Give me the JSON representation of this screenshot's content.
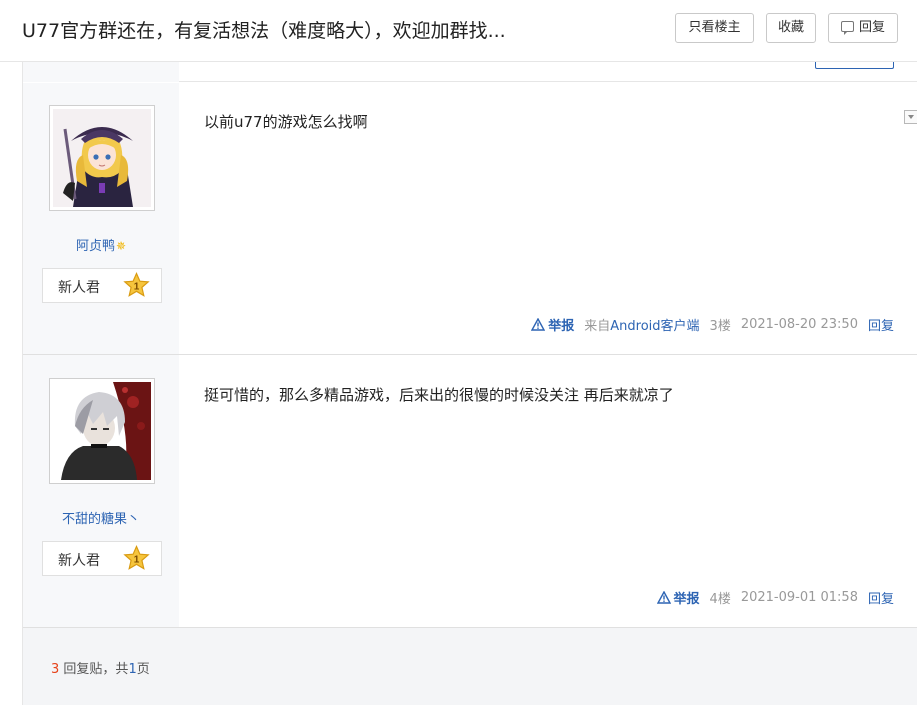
{
  "header": {
    "title": "U77官方群还在，有复活想法（难度略大），欢迎加群找...",
    "buttons": {
      "only_op": "只看楼主",
      "favorite": "收藏",
      "reply": "回复"
    }
  },
  "posts": [
    {
      "username": "阿贞鸭",
      "level_name": "新人君",
      "level_num": "1",
      "content": "以前u77的游戏怎么找啊",
      "report": "举报",
      "client_prefix": "来自",
      "client_name": "Android客户端",
      "floor": "3楼",
      "time": "2021-08-20 23:50",
      "reply": "回复"
    },
    {
      "username": "不甜的糖果丶",
      "level_name": "新人君",
      "level_num": "1",
      "content": "挺可惜的，那么多精品游戏，后来出的很慢的时候没关注 再后来就凉了",
      "report": "举报",
      "floor": "4楼",
      "time": "2021-09-01 01:58",
      "reply": "回复"
    }
  ],
  "footer": {
    "reply_count": "3",
    "reply_label": "回复贴，共",
    "page_count": "1",
    "page_label": "页"
  },
  "colors": {
    "link": "#2d64b3",
    "accent_red": "#e6421a",
    "author_bg": "#f7f8fa"
  }
}
